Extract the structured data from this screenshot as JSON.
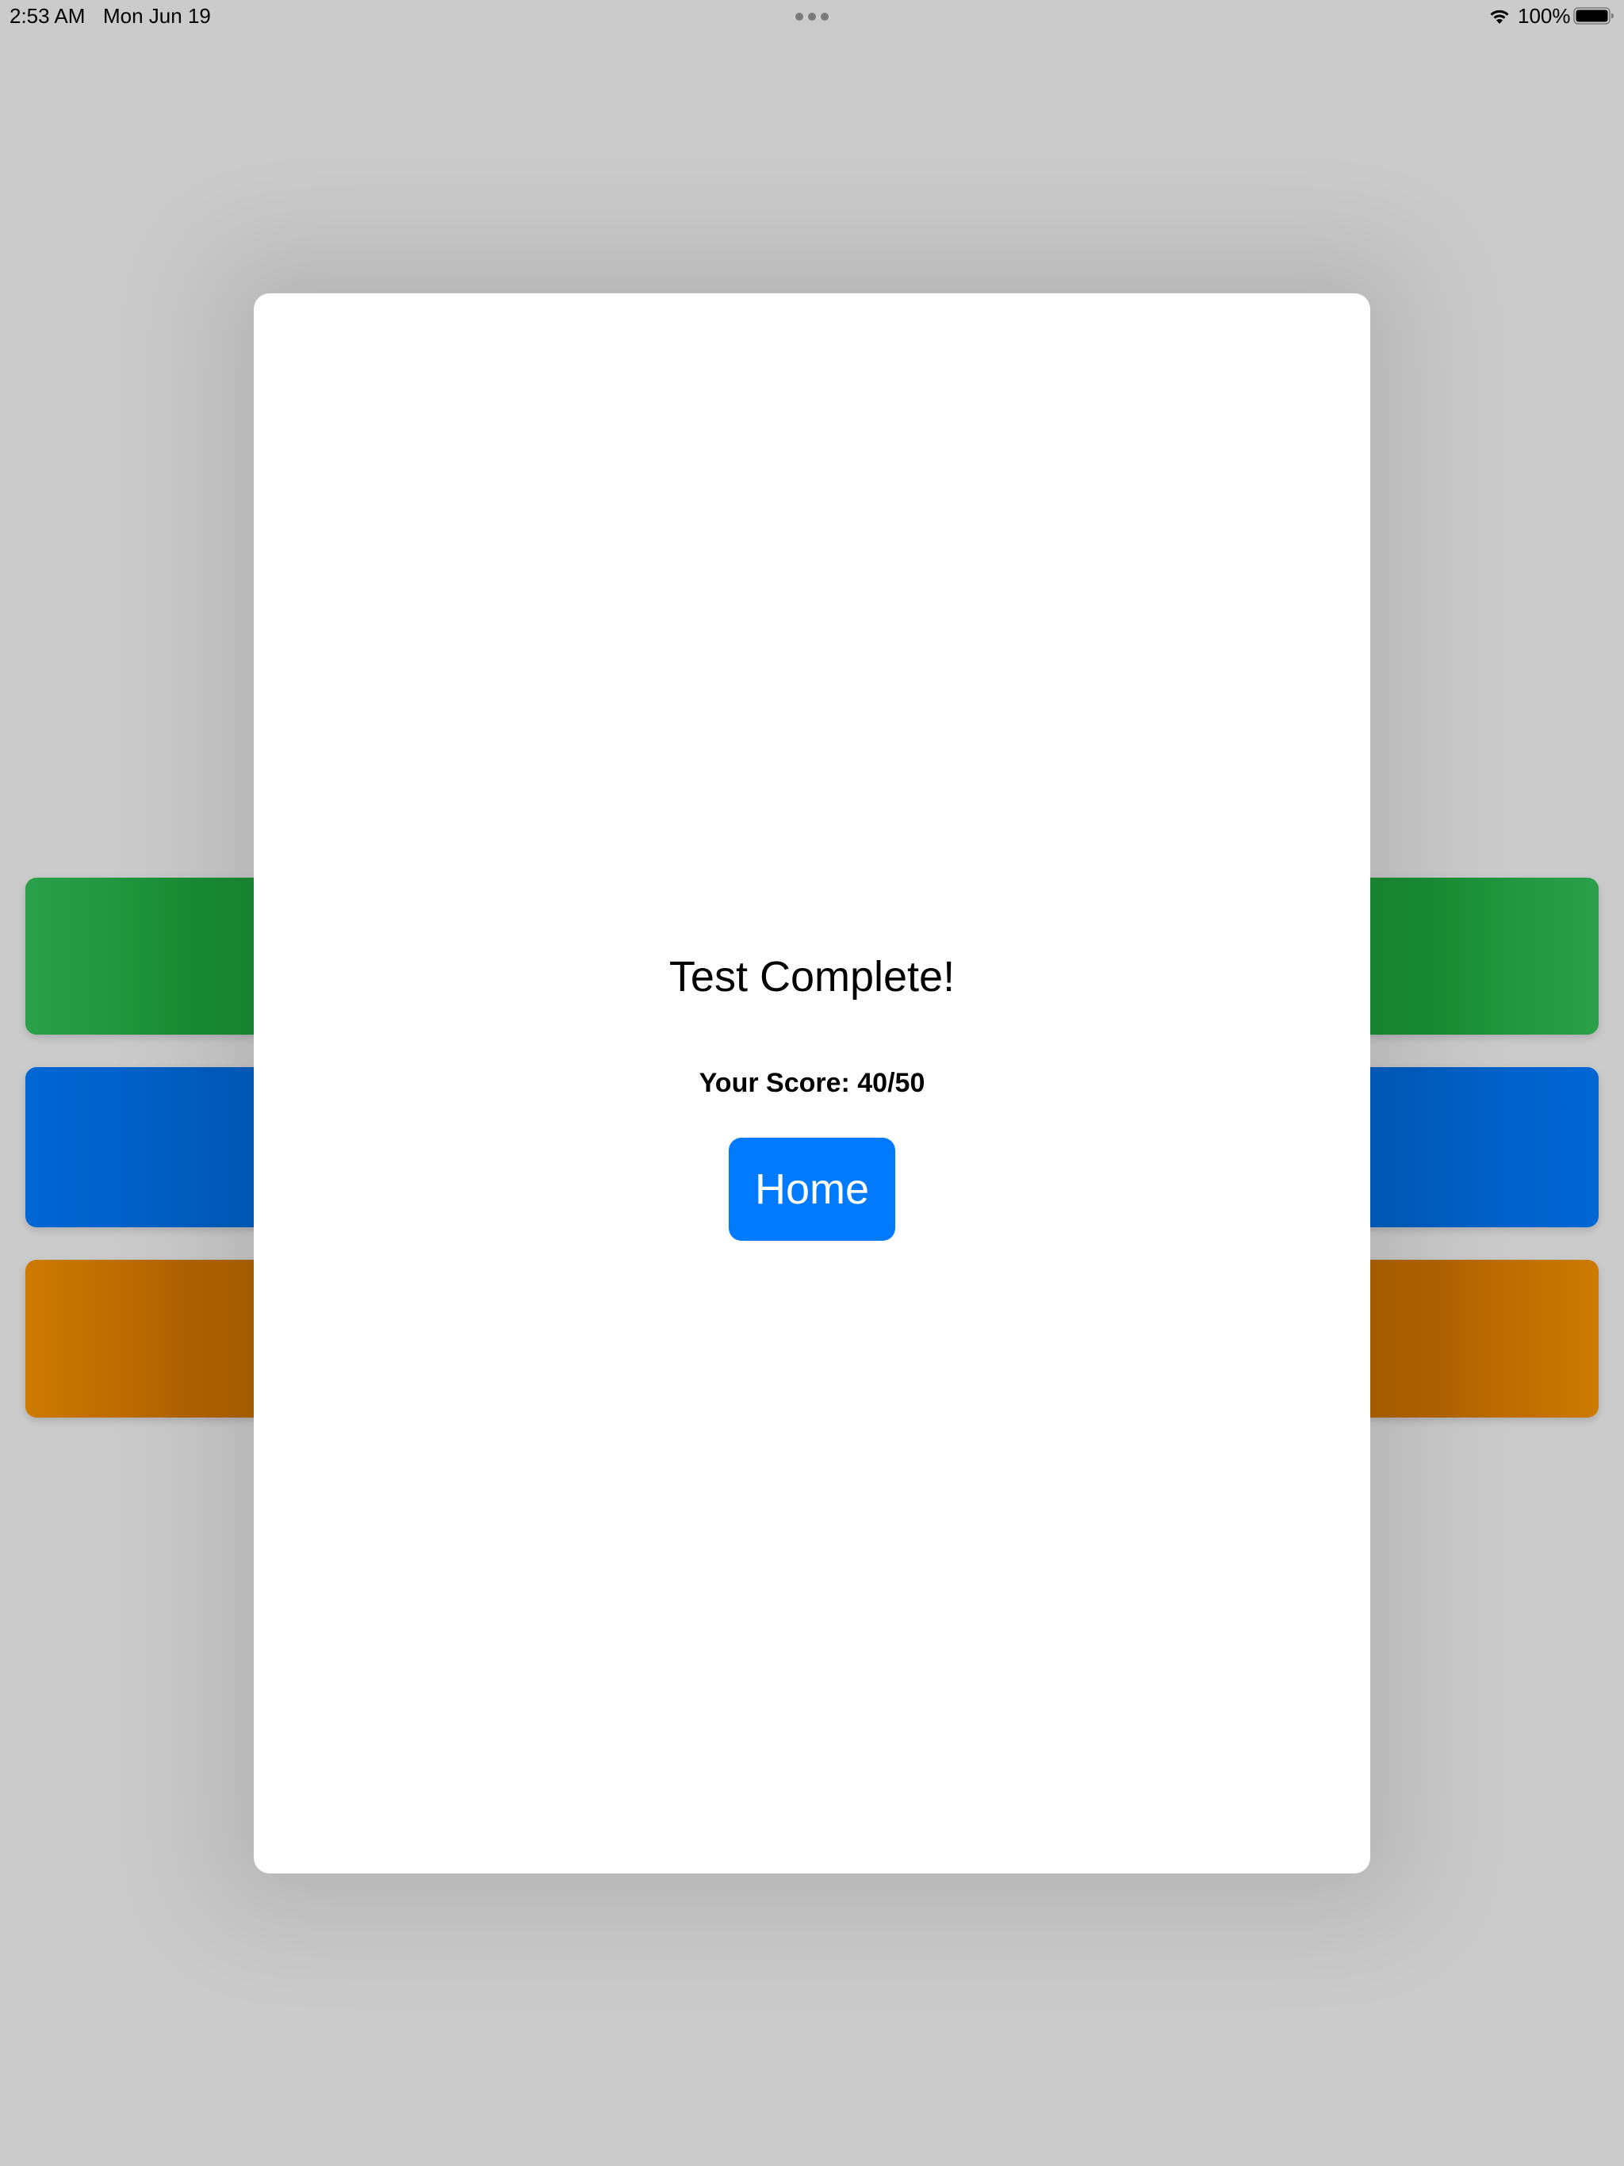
{
  "status_bar": {
    "time": "2:53 AM",
    "date": "Mon Jun 19",
    "battery_percent": "100%",
    "battery_level": 1.0,
    "icons": [
      "multitasking-dots-icon",
      "wifi-icon",
      "battery-icon"
    ]
  },
  "background_bars": [
    {
      "color": "#1a8f35"
    },
    {
      "color": "#005fc4"
    },
    {
      "color": "#b36400"
    }
  ],
  "modal": {
    "title": "Test Complete!",
    "score_label": "Your Score: 40/50",
    "score": 40,
    "score_total": 50,
    "home_button_label": "Home"
  },
  "colors": {
    "accent": "#007aff",
    "background": "#cbcbcb",
    "modal_background": "#ffffff"
  }
}
